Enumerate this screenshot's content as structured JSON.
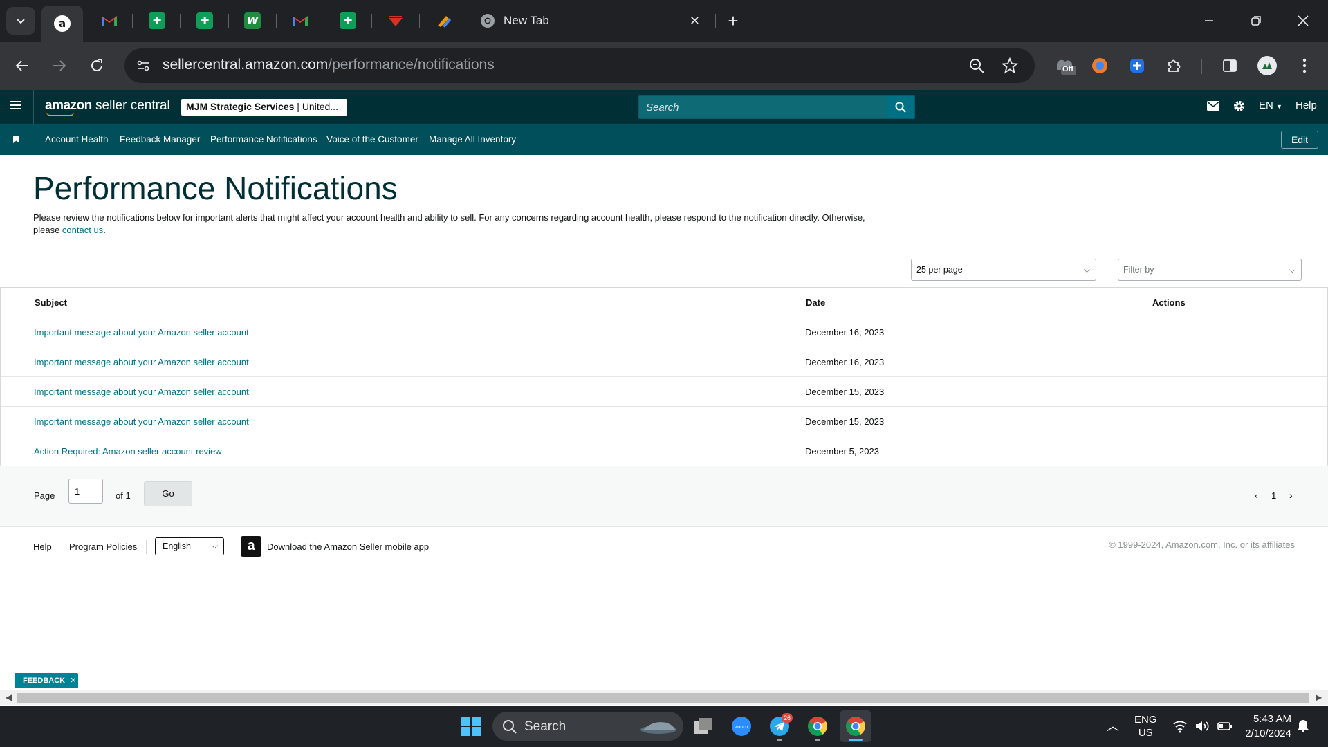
{
  "browser": {
    "tabs": [
      {
        "name": "amazon",
        "icon": "amazon-icon",
        "active": true
      },
      {
        "name": "gmail-1",
        "icon": "gmail-icon"
      },
      {
        "name": "sheets-1",
        "icon": "sheets-icon"
      },
      {
        "name": "sheets-2",
        "icon": "sheets-icon"
      },
      {
        "name": "w-app",
        "icon": "w-app-icon"
      },
      {
        "name": "gmail-2",
        "icon": "gmail-icon"
      },
      {
        "name": "sheets-3",
        "icon": "sheets-icon"
      },
      {
        "name": "red-logo",
        "icon": "red-logo-icon"
      },
      {
        "name": "pencil-app",
        "icon": "pencil-app-icon"
      }
    ],
    "new_tab_title": "New Tab",
    "url_domain": "sellercentral.amazon.com",
    "url_path": "/performance/notifications",
    "extension_badge": "Off"
  },
  "header": {
    "logo_word1": "amazon",
    "logo_word2": "seller central",
    "account_bold": "MJM Strategic Services",
    "account_rest": " | United...",
    "search_placeholder": "Search",
    "lang": "EN",
    "help": "Help"
  },
  "nav": {
    "links": [
      "Account Health",
      "Feedback Manager",
      "Performance Notifications",
      "Voice of the Customer",
      "Manage All Inventory"
    ],
    "edit": "Edit"
  },
  "page": {
    "title": "Performance Notifications",
    "intro": "Please review the notifications below for important alerts that might affect your account health and ability to sell. For any concerns regarding account health, please respond to the notification directly. Otherwise, please ",
    "intro_link": "contact us",
    "intro_end": ".",
    "per_page": "25 per page",
    "filter_placeholder": "Filter by"
  },
  "table": {
    "columns": [
      "Subject",
      "Date",
      "Actions"
    ],
    "rows": [
      {
        "subject": "Important message about your Amazon seller account",
        "date": "December 16, 2023"
      },
      {
        "subject": "Important message about your Amazon seller account",
        "date": "December 16, 2023"
      },
      {
        "subject": "Important message about your Amazon seller account",
        "date": "December 15, 2023"
      },
      {
        "subject": "Important message about your Amazon seller account",
        "date": "December 15, 2023"
      },
      {
        "subject": "Action Required: Amazon seller account review",
        "date": "December 5, 2023"
      }
    ]
  },
  "pager": {
    "page_label": "Page",
    "page_value": "1",
    "of_label": "of 1",
    "go": "Go",
    "current": "1"
  },
  "footer": {
    "help": "Help",
    "policies": "Program Policies",
    "language": "English",
    "app_download": "Download the Amazon Seller mobile app",
    "copyright": "© 1999-2024, Amazon.com, Inc. or its affiliates"
  },
  "feedback": "FEEDBACK",
  "taskbar": {
    "search": "Search",
    "lang_line1": "ENG",
    "lang_line2": "US",
    "time": "5:43 AM",
    "date": "2/10/2024",
    "telegram_badge": "26"
  },
  "colors": {
    "header_bg": "#002f36",
    "nav_bg": "#014f5a",
    "link": "#007185",
    "search_bg": "#0e6a75"
  }
}
